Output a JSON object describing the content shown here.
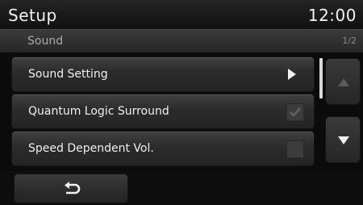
{
  "header": {
    "title": "Setup",
    "clock": "12:00"
  },
  "subheader": {
    "section": "Sound",
    "page": "1/2"
  },
  "menu": [
    {
      "label": "Sound Setting",
      "control": "chevron-right-icon"
    },
    {
      "label": "Quantum Logic Surround",
      "control": "checkbox",
      "checked": true
    },
    {
      "label": "Speed Dependent Vol.",
      "control": "checkbox",
      "checked": false
    }
  ],
  "scroll": {
    "up_enabled": false,
    "down_enabled": true
  },
  "footer": {
    "back_icon": "back-arrow-icon"
  },
  "colors": {
    "background": "#0b0b0b",
    "row": "#2b2b2b",
    "text": "#f0f0f0",
    "muted": "#a9a9a9"
  }
}
